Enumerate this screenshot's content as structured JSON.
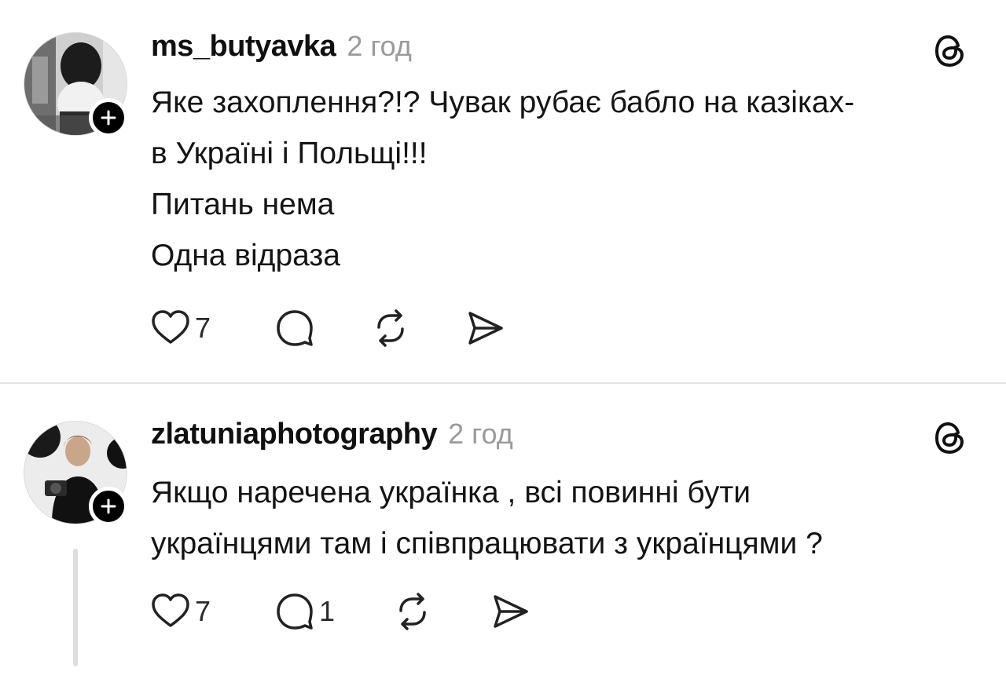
{
  "posts": [
    {
      "username": "ms_butyavka",
      "time": "2 год",
      "lines": [
        "Яке захоплення?!? Чувак рубає бабло на казіках-",
        "в Україні і Польщі!!!",
        "Питань нема",
        "Одна відраза"
      ],
      "likes": "7",
      "replies": "",
      "icons": {
        "like": "heart-icon",
        "reply": "comment-icon",
        "repost": "repost-icon",
        "share": "send-icon",
        "app": "threads-logo-icon",
        "follow": "plus-icon"
      }
    },
    {
      "username": "zlatuniaphotography",
      "time": "2 год",
      "lines": [
        "Якщо наречена українка , всі повинні бути",
        "українцями там і співпрацювати з українцями ?"
      ],
      "likes": "7",
      "replies": "1",
      "icons": {
        "like": "heart-icon",
        "reply": "comment-icon",
        "repost": "repost-icon",
        "share": "send-icon",
        "app": "threads-logo-icon",
        "follow": "plus-icon"
      }
    }
  ],
  "colors": {
    "text": "#101010",
    "muted": "#9a9a9a",
    "divider": "#e4e4e4",
    "badge": "#000000"
  }
}
